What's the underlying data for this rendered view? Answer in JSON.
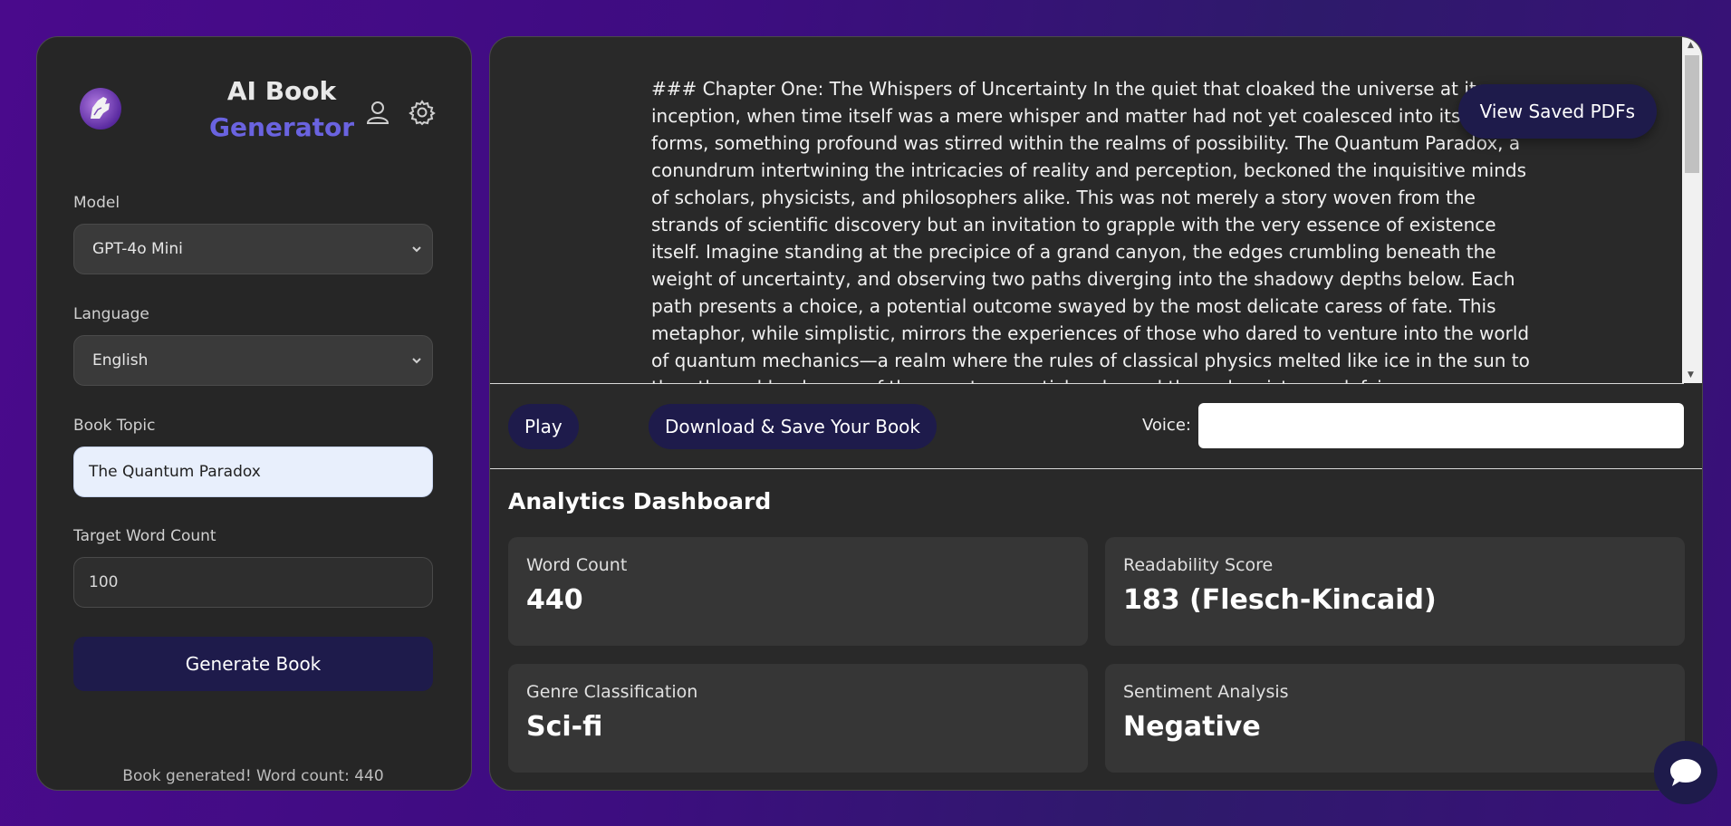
{
  "sidebar": {
    "title_line1": "AI Book",
    "title_line2": "Generator",
    "icons": [
      "user-icon",
      "gear-icon"
    ],
    "model_label": "Model",
    "model_value": "GPT-4o Mini",
    "language_label": "Language",
    "language_value": "English",
    "topic_label": "Book Topic",
    "topic_value": "The Quantum Paradox",
    "word_count_label": "Target Word Count",
    "word_count_value": "100",
    "generate_button": "Generate Book",
    "status_text": "Book generated! Word count: 440"
  },
  "main": {
    "book_text": "### Chapter One: The Whispers of Uncertainty In the quiet that cloaked the universe at its inception, when time itself was a mere whisper and matter had not yet coalesced into its myriad forms, something profound was stirred within the realms of possibility. The Quantum Paradox, a conundrum intertwining the intricacies of reality and perception, beckoned the inquisitive minds of scholars, physicists, and philosophers alike. This was not merely a story woven from the strands of scientific discovery but an invitation to grapple with the very essence of existence itself. Imagine standing at the precipice of a grand canyon, the edges crumbling beneath the weight of uncertainty, and observing two paths diverging into the shadowy depths below. Each path presents a choice, a potential outcome swayed by the most delicate caress of fate. This metaphor, while simplistic, mirrors the experiences of those who dared to venture into the world of quantum mechanics—a realm where the rules of classical physics melted like ice in the sun to the ethereal landscape of the quantum particles danced through existence defying",
    "view_saved_button": "View Saved PDFs",
    "play_button": "Play",
    "download_button": "Download & Save Your Book",
    "voice_label": "Voice:",
    "voice_value": ""
  },
  "analytics": {
    "title": "Analytics Dashboard",
    "cards": [
      {
        "label": "Word Count",
        "value": "440"
      },
      {
        "label": "Readability Score",
        "value": "183 (Flesch-Kincaid)"
      },
      {
        "label": "Genre Classification",
        "value": "Sci-fi"
      },
      {
        "label": "Sentiment Analysis",
        "value": "Negative"
      }
    ]
  },
  "colors": {
    "accent": "#6a63e0",
    "button_dark": "#1e1b4b",
    "panel": "#262626",
    "background_gradient": "#4a0a8c"
  }
}
